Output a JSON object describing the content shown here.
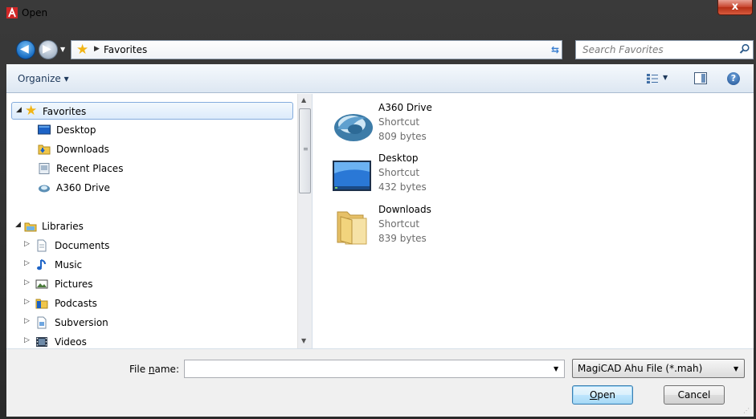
{
  "window": {
    "title": "Open",
    "close_label": "x"
  },
  "address": {
    "path_item": "Favorites",
    "search_placeholder": "Search Favorites"
  },
  "toolbar": {
    "organize_label": "Organize ▾"
  },
  "nav": {
    "favorites_header": "Favorites",
    "favorites": [
      {
        "label": "Desktop",
        "icon": "desktop-icon"
      },
      {
        "label": "Downloads",
        "icon": "downloads-folder-icon"
      },
      {
        "label": "Recent Places",
        "icon": "recent-places-icon"
      },
      {
        "label": "A360 Drive",
        "icon": "a360-drive-icon"
      }
    ],
    "libraries_header": "Libraries",
    "libraries": [
      {
        "label": "Documents",
        "icon": "documents-icon"
      },
      {
        "label": "Music",
        "icon": "music-icon"
      },
      {
        "label": "Pictures",
        "icon": "pictures-icon"
      },
      {
        "label": "Podcasts",
        "icon": "podcasts-icon"
      },
      {
        "label": "Subversion",
        "icon": "subversion-icon"
      },
      {
        "label": "Videos",
        "icon": "videos-icon"
      }
    ]
  },
  "files": [
    {
      "name": "A360 Drive",
      "type": "Shortcut",
      "size": "809 bytes",
      "icon": "a360-drive-icon"
    },
    {
      "name": "Desktop",
      "type": "Shortcut",
      "size": "432 bytes",
      "icon": "desktop-icon"
    },
    {
      "name": "Downloads",
      "type": "Shortcut",
      "size": "839 bytes",
      "icon": "folder-icon"
    }
  ],
  "bottom": {
    "filename_label_pre": "File ",
    "filename_label_u": "n",
    "filename_label_post": "ame:",
    "filename_value": "",
    "filetype_selected": "MagiCAD Ahu File (*.mah)",
    "open_u": "O",
    "open_rest": "pen",
    "cancel_label": "Cancel"
  },
  "colors": {
    "accent": "#1a6fc4",
    "selection_border": "#84acdd",
    "close_red": "#c7432b"
  }
}
